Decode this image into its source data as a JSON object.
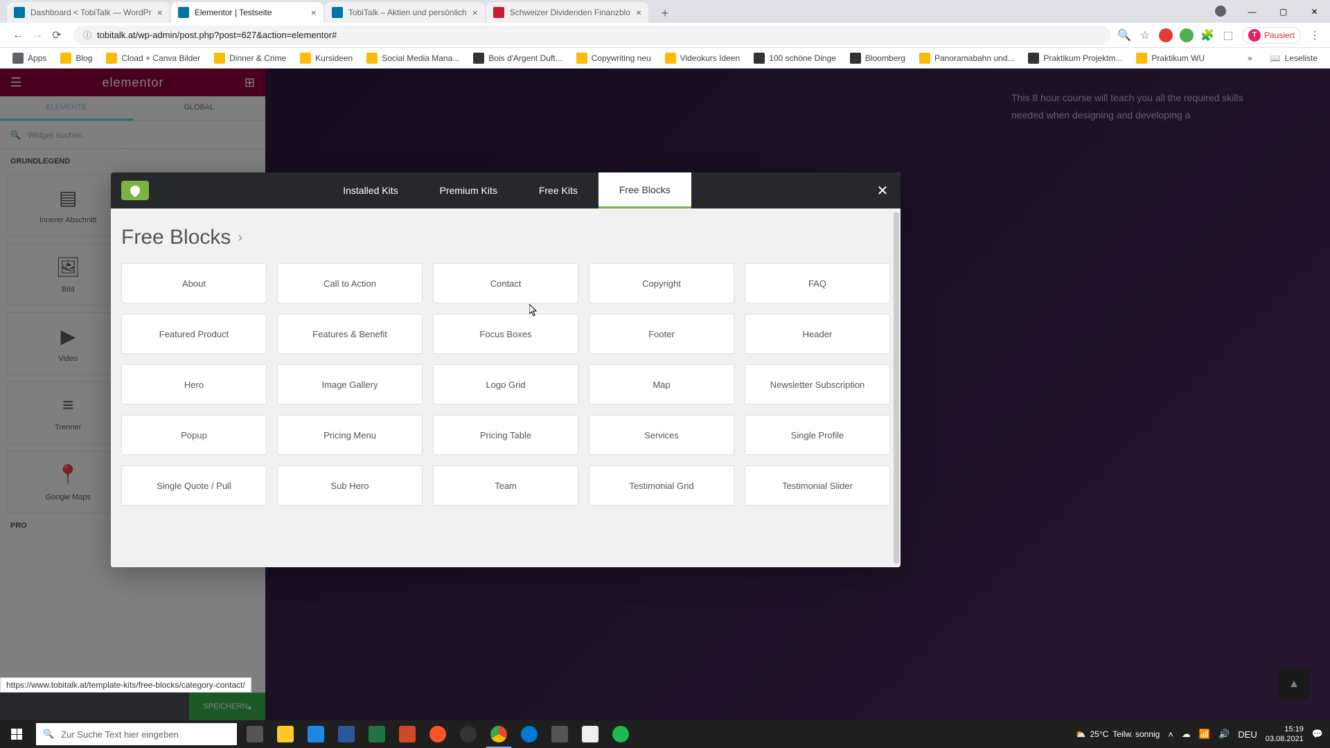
{
  "browser": {
    "tabs": [
      {
        "title": "Dashboard < TobiTalk — WordPr"
      },
      {
        "title": "Elementor | Testseite"
      },
      {
        "title": "TobiTalk – Aktien und persönlich"
      },
      {
        "title": "Schweizer Dividenden Finanzblo"
      }
    ],
    "url": "tobitalk.at/wp-admin/post.php?post=627&action=elementor#",
    "profile_label": "Pausiert",
    "profile_initial": "T"
  },
  "bookmarks": {
    "apps": "Apps",
    "items": [
      "Blog",
      "Cload + Canva Bilder",
      "Dinner & Crime",
      "Kursideen",
      "Social Media Mana...",
      "Bois d'Argent Duft...",
      "Copywriting neu",
      "Videokurs Ideen",
      "100 schöne Dinge",
      "Bloomberg",
      "Panoramabahn und...",
      "Praktikum Projektm...",
      "Praktikum WU"
    ],
    "readlist": "Leseliste"
  },
  "elementor": {
    "logo": "elementor",
    "tabs": {
      "elements": "ELEMENTE",
      "global": "GLOBAL"
    },
    "search_placeholder": "Widget suchen",
    "category": "GRUNDLEGEND",
    "widgets": [
      "Innerer Abschnitt",
      "Bild",
      "Video",
      "Trenner",
      "Google Maps"
    ],
    "pro_label": "PRO",
    "save": "SPEICHERN"
  },
  "canvas": {
    "text": "This 8 hour course will teach you all the required skills needed when designing and developing a"
  },
  "modal": {
    "tabs": [
      "Installed Kits",
      "Premium Kits",
      "Free Kits",
      "Free Blocks"
    ],
    "active_tab": "Free Blocks",
    "title": "Free Blocks",
    "blocks": [
      "About",
      "Call to Action",
      "Contact",
      "Copyright",
      "FAQ",
      "Featured Product",
      "Features & Benefit",
      "Focus Boxes",
      "Footer",
      "Header",
      "Hero",
      "Image Gallery",
      "Logo Grid",
      "Map",
      "Newsletter Subscription",
      "Popup",
      "Pricing Menu",
      "Pricing Table",
      "Services",
      "Single Profile",
      "Single Quote / Pull",
      "Sub Hero",
      "Team",
      "Testimonial Grid",
      "Testimonial Slider"
    ]
  },
  "status_link": "https://www.tobitalk.at/template-kits/free-blocks/category-contact/",
  "taskbar": {
    "search_placeholder": "Zur Suche Text hier eingeben",
    "weather_temp": "25°C",
    "weather_desc": "Teilw. sonnig",
    "time": "15:19",
    "date": "03.08.2021",
    "lang": "DEU"
  }
}
